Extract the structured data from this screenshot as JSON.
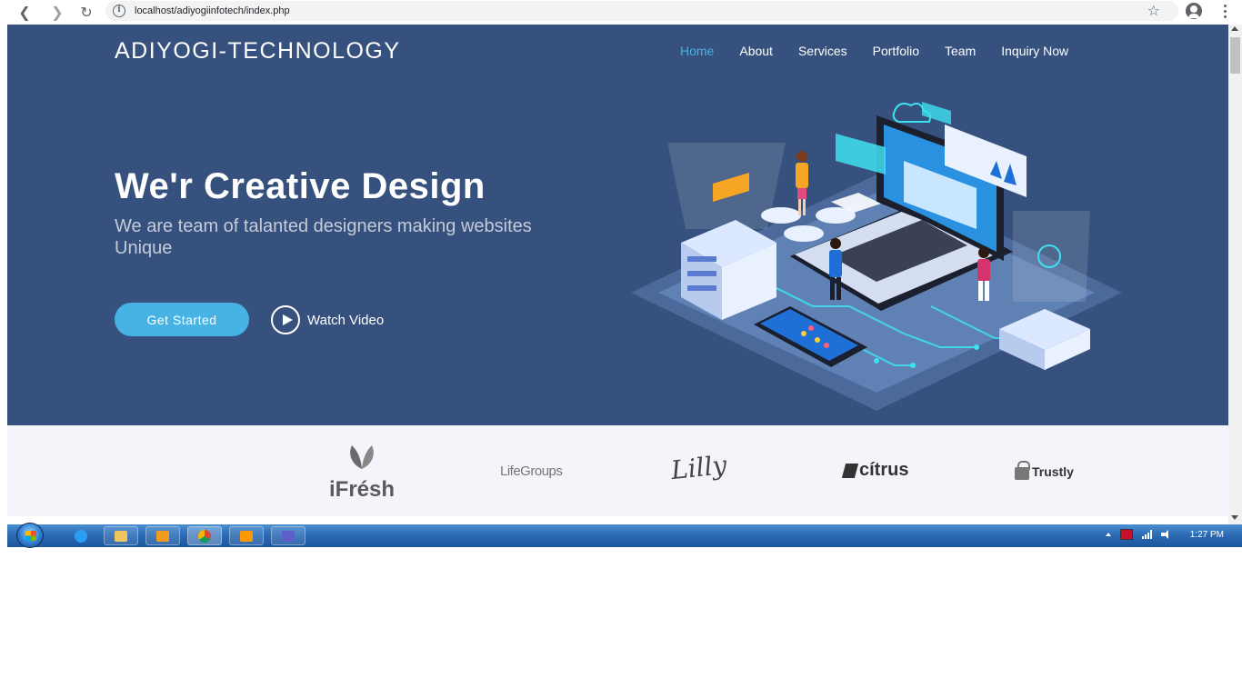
{
  "browser": {
    "url": "localhost/adiyogiinfotech/index.php",
    "icons": [
      "back-icon",
      "forward-icon",
      "reload-icon",
      "info-icon",
      "star-icon",
      "account-icon",
      "menu-icon"
    ]
  },
  "site": {
    "brand": "ADIYOGI-TECHNOLOGY",
    "nav": [
      {
        "label": "Home",
        "active": true
      },
      {
        "label": "About",
        "active": false
      },
      {
        "label": "Services",
        "active": false
      },
      {
        "label": "Portfolio",
        "active": false
      },
      {
        "label": "Team",
        "active": false
      },
      {
        "label": "Inquiry Now",
        "active": false
      }
    ],
    "hero": {
      "headline": "We'r Creative Design",
      "subline": "We are team of talanted designers making websites Unique",
      "cta_label": "Get Started",
      "watch_label": "Watch Video"
    },
    "clients": {
      "ifresh": "iFrésh",
      "lifegroups": "LifeGroups",
      "lilly": "Lilly",
      "citrus": "cítrus",
      "trustly": "Trustly"
    }
  },
  "taskbar": {
    "clock": "1:27 PM",
    "apps": [
      "internet-explorer",
      "windows-explorer",
      "media-player",
      "chrome",
      "sublime-text",
      "teams"
    ]
  },
  "colors": {
    "hero_bg": "#37517e",
    "accent": "#47b2e4",
    "clients_bg": "#f3f5fa"
  }
}
